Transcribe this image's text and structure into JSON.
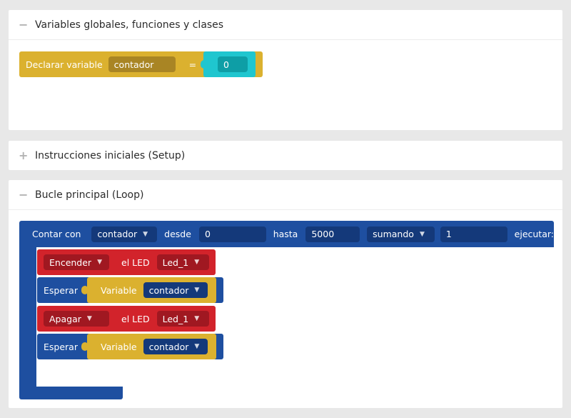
{
  "panels": {
    "globals": {
      "title": "Variables globales, funciones y clases",
      "toggle": "−"
    },
    "setup": {
      "title": "Instrucciones iniciales (Setup)",
      "toggle": "+"
    },
    "loop": {
      "title": "Bucle principal (Loop)",
      "toggle": "−"
    }
  },
  "declare_block": {
    "label": "Declarar variable",
    "name": "contador",
    "equals": "=",
    "value": "0"
  },
  "for_block": {
    "label": "Contar con",
    "var": "contador",
    "from_label": "desde",
    "from": "0",
    "to_label": "hasta",
    "to": "5000",
    "step_mode": "sumando",
    "step": "1",
    "do_label": "ejecutar:"
  },
  "led_on": {
    "action": "Encender",
    "led_label": "el LED",
    "led": "Led_1"
  },
  "wait_1": {
    "label": "Esperar",
    "var_label": "Variable",
    "var": "contador"
  },
  "led_off": {
    "action": "Apagar",
    "led_label": "el LED",
    "led": "Led_1"
  },
  "wait_2": {
    "label": "Esperar",
    "var_label": "Variable",
    "var": "contador"
  },
  "colors": {
    "yellow": "#dbb12f",
    "cyan": "#1fc6cf",
    "blue": "#1e4fa0",
    "red": "#d2232b"
  }
}
